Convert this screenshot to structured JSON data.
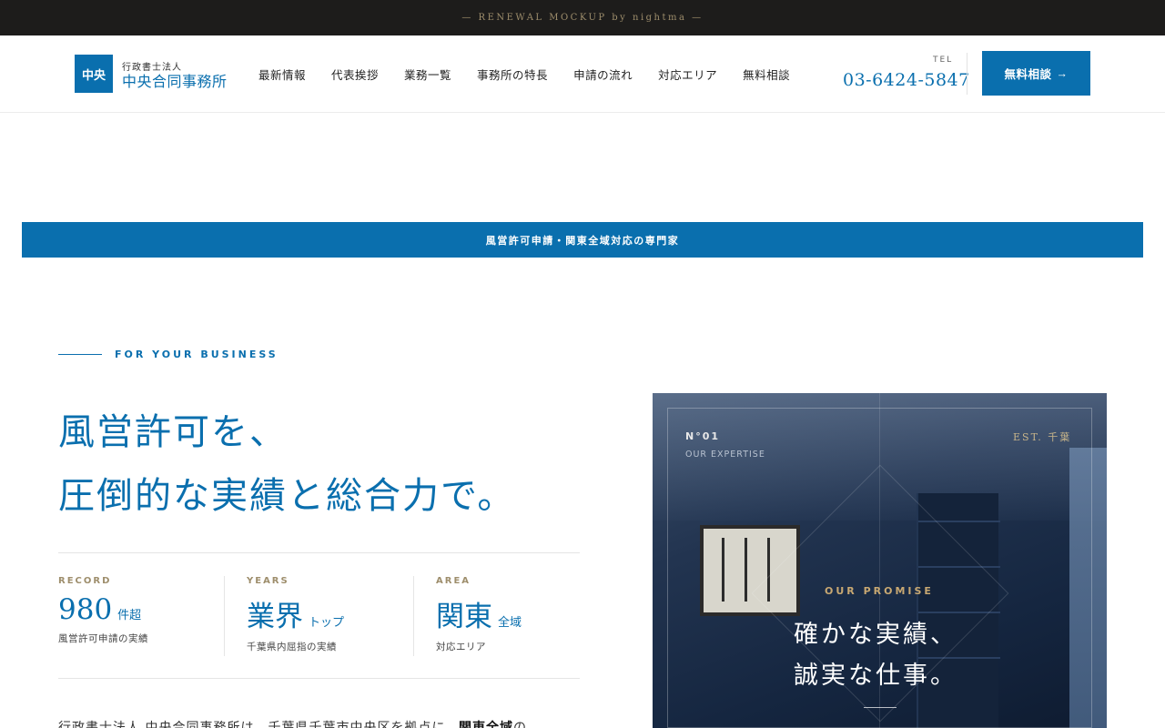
{
  "topbar": {
    "text": "— RENEWAL MOCKUP   by nightma —"
  },
  "header": {
    "logo_mark": "中央",
    "logo_sub": "行政書士法人",
    "logo_main": "中央合同事務所",
    "nav": [
      "最新情報",
      "代表挨拶",
      "業務一覧",
      "事務所の特長",
      "申請の流れ",
      "対応エリア",
      "無料相談"
    ],
    "tel_label": "TEL",
    "tel_number": "03-6424-5847",
    "cta_label": "無料相談",
    "cta_arrow": "→"
  },
  "strip": {
    "text": "風営許可申請・関東全域対応の専門家"
  },
  "hero": {
    "eyebrow": "FOR YOUR BUSINESS",
    "headline_line1": "風営許可を、",
    "headline_line2": "圧倒的な実績と総合力で。",
    "stats": [
      {
        "label": "RECORD",
        "value": "980",
        "unit": "件超",
        "desc": "風営許可申請の実績"
      },
      {
        "label": "YEARS",
        "value": "業界",
        "unit": "トップ",
        "desc": "千葉県内屈指の実績"
      },
      {
        "label": "AREA",
        "value": "関東",
        "unit": "全域",
        "desc": "対応エリア"
      }
    ],
    "body_text_start": "行政書士法人 中央合同事務所は、千葉県千葉市中央区を拠点に、",
    "body_text_bold": "関東全域",
    "body_text_end": "の"
  },
  "card": {
    "number": "N°01",
    "expertise": "OUR EXPERTISE",
    "est": "EST. 千葉",
    "promise_label": "OUR PROMISE",
    "promise_line1": "確かな実績、",
    "promise_line2": "誠実な仕事。"
  },
  "colors": {
    "brand_blue": "#0a6fae",
    "gold": "#9e8e6c",
    "dark": "#1d1c1b"
  },
  "icons": {
    "cta": "arrow-right-icon"
  }
}
